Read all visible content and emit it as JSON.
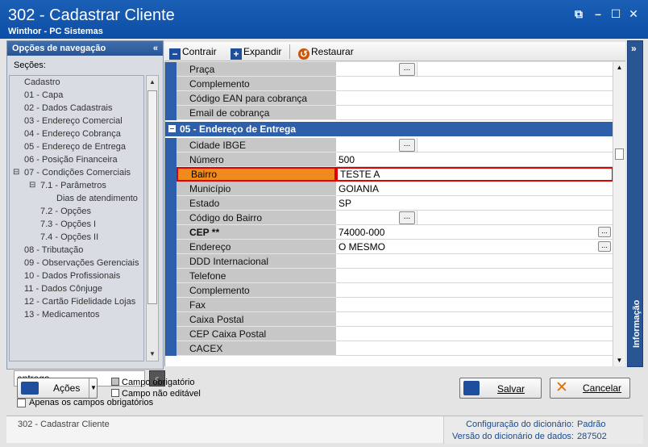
{
  "window": {
    "title": "302 - Cadastrar Cliente",
    "subtitle": "Winthor - PC Sistemas",
    "controls": {
      "restore": "⧉",
      "minimize": "–",
      "maximize": "☐",
      "close": "✕"
    }
  },
  "nav": {
    "header": "Opções de navegação",
    "sections_label": "Seções:",
    "items": [
      {
        "label": "Cadastro",
        "indent": 0
      },
      {
        "label": "01 - Capa",
        "indent": 1
      },
      {
        "label": "02 - Dados Cadastrais",
        "indent": 1
      },
      {
        "label": "03 - Endereço Comercial",
        "indent": 1
      },
      {
        "label": "04 - Endereço Cobrança",
        "indent": 1
      },
      {
        "label": "05 - Endereço de Entrega",
        "indent": 1
      },
      {
        "label": "06 - Posição Financeira",
        "indent": 1
      },
      {
        "label": "07 - Condições Comerciais",
        "indent": 1,
        "expander": "⊟"
      },
      {
        "label": "7.1 - Parâmetros",
        "indent": 2,
        "expander": "⊟"
      },
      {
        "label": "Dias de atendimento",
        "indent": 3
      },
      {
        "label": "7.2 - Opções",
        "indent": 2
      },
      {
        "label": "7.3 - Opções I",
        "indent": 2
      },
      {
        "label": "7.4 - Opções II",
        "indent": 2
      },
      {
        "label": "08 - Tributação",
        "indent": 1
      },
      {
        "label": "09 - Observações Gerenciais",
        "indent": 1
      },
      {
        "label": "10 - Dados Profissionais",
        "indent": 1
      },
      {
        "label": "11 - Dados Cônjuge",
        "indent": 1
      },
      {
        "label": "12 - Cartão Fidelidade Lojas",
        "indent": 1
      },
      {
        "label": "13 - Medicamentos",
        "indent": 1
      }
    ],
    "search_value": "entrega",
    "required_only_label": "Apenas os campos obrigatórios"
  },
  "toolbar": {
    "collapse_label": "Contrair",
    "expand_label": "Expandir",
    "restore_label": "Restaurar"
  },
  "grid": {
    "rows_top": [
      {
        "label": "Praça",
        "value": "",
        "lookup": true
      },
      {
        "label": "Complemento",
        "value": ""
      },
      {
        "label": "Código EAN para cobrança",
        "value": ""
      },
      {
        "label": "Email de cobrança",
        "value": ""
      }
    ],
    "section_title": "05 - Endereço de Entrega",
    "rows": [
      {
        "label": "Cidade IBGE",
        "value": "",
        "lookup": true
      },
      {
        "label": "Número",
        "value": "500"
      },
      {
        "label": "Bairro",
        "value": "TESTE A",
        "selected": true
      },
      {
        "label": "Município",
        "value": "GOIANIA"
      },
      {
        "label": "Estado",
        "value": "SP"
      },
      {
        "label": "Código do Bairro",
        "value": "",
        "lookup": true
      },
      {
        "label": "CEP **",
        "value": "74000-000",
        "bold": true,
        "ellipsis": true
      },
      {
        "label": "Endereço",
        "value": "O MESMO",
        "ellipsis": true
      },
      {
        "label": "DDD Internacional",
        "value": ""
      },
      {
        "label": "Telefone",
        "value": ""
      },
      {
        "label": "Complemento",
        "value": ""
      },
      {
        "label": "Fax",
        "value": ""
      },
      {
        "label": "Caixa Postal",
        "value": ""
      },
      {
        "label": "CEP Caixa Postal",
        "value": ""
      },
      {
        "label": "CACEX",
        "value": ""
      }
    ]
  },
  "info_panel": {
    "label": "Informação"
  },
  "bottom": {
    "actions_label": "Ações",
    "legend_required": "Campo obrigatório",
    "legend_readonly": "Campo não editável",
    "save_label": "Salvar",
    "cancel_label": "Cancelar"
  },
  "status": {
    "left": "302 - Cadastrar Cliente",
    "dict_config_label": "Configuração do dicionário:",
    "dict_config_value": "Padrão",
    "dict_version_label": "Versão do dicionário de dados:",
    "dict_version_value": "287502"
  },
  "colors": {
    "title_bar": "#1a5fb5",
    "section_blue": "#2e5fab",
    "selected_label": "#f08a1c",
    "selected_border": "#e00000",
    "status_text": "#1a4a8c"
  }
}
